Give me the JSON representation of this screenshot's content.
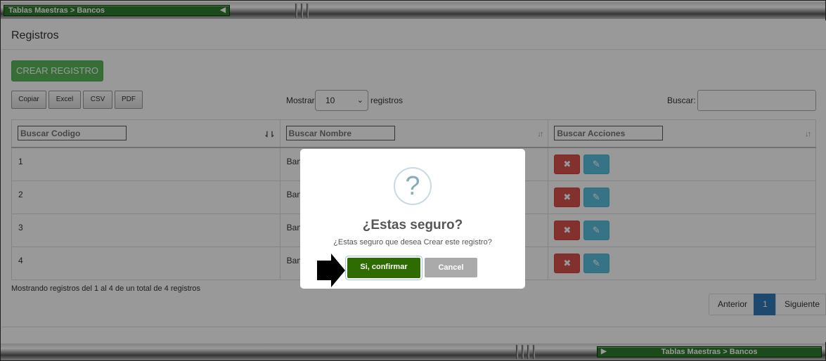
{
  "breadcrumb": {
    "label": "Tablas Maestras > Bancos"
  },
  "page": {
    "title": "Registros"
  },
  "toolbar": {
    "create_label": "CREAR REGISTRO",
    "export": [
      "Copiar",
      "Excel",
      "CSV",
      "PDF"
    ],
    "show_label": "Mostrar",
    "show_value": "10",
    "show_suffix": "registros",
    "search_label": "Buscar:"
  },
  "table": {
    "columns": [
      {
        "placeholder": "Buscar Codigo"
      },
      {
        "placeholder": "Buscar Nombre"
      },
      {
        "placeholder": "Buscar Acciones"
      }
    ],
    "rows": [
      {
        "code": "1",
        "name": "Banc"
      },
      {
        "code": "2",
        "name": "Banc"
      },
      {
        "code": "3",
        "name": "Banc"
      },
      {
        "code": "4",
        "name": "Banc"
      }
    ]
  },
  "info": "Mostrando registros del 1 al 4 de un total de 4 registros",
  "pagination": {
    "prev": "Anterior",
    "current": "1",
    "next": "Siguiente"
  },
  "modal": {
    "icon": "?",
    "title": "¿Estas seguro?",
    "text": "¿Estas seguro que desea Crear este registro?",
    "confirm": "Si, confirmar",
    "cancel": "Cancel"
  },
  "icons": {
    "delete": "✖",
    "edit": "✎"
  },
  "colors": {
    "create": "#5cb85c",
    "confirm": "#2e6b00",
    "delete": "#d9534f",
    "edit": "#5bc0de",
    "pager_active": "#337ab7"
  }
}
